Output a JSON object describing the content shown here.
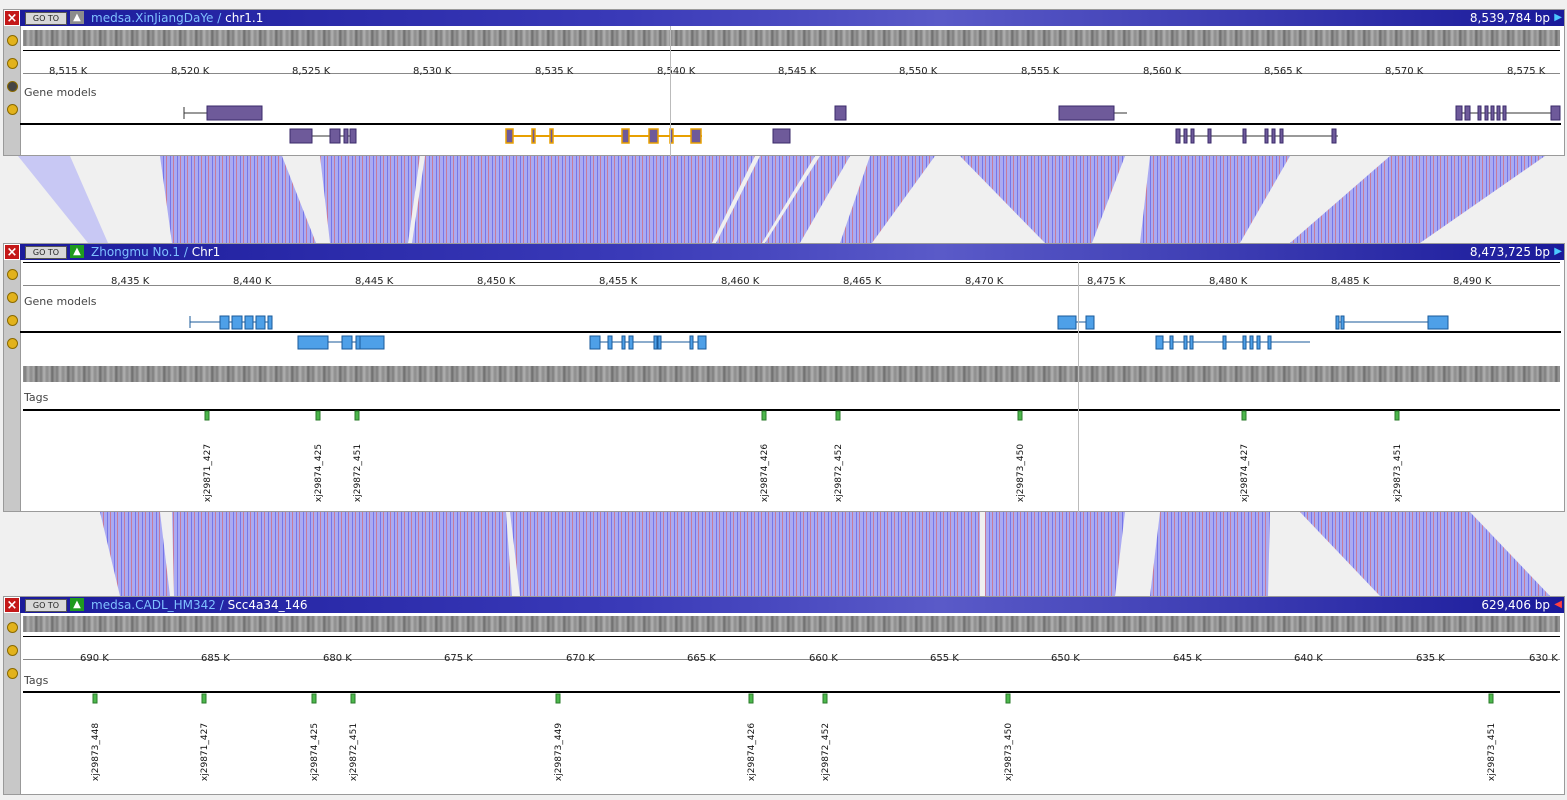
{
  "panels": [
    {
      "id": "top",
      "org": "medsa.XinJiangDaYe",
      "seq": "chr1.1",
      "bp": "8,539,784 bp",
      "goto_label": "GO TO",
      "arrow": "▶",
      "ticks": [
        "8,515 K",
        "8,520 K",
        "8,525 K",
        "8,530 K",
        "8,535 K",
        "8,540 K",
        "8,545 K",
        "8,550 K",
        "8,555 K",
        "8,560 K",
        "8,565 K",
        "8,570 K",
        "8,575 K"
      ],
      "gene_label": "Gene models"
    },
    {
      "id": "middle",
      "org": "Zhongmu No.1",
      "seq": "Chr1",
      "bp": "8,473,725 bp",
      "goto_label": "GO TO",
      "arrow": "▶",
      "ticks": [
        "8,435 K",
        "8,440 K",
        "8,445 K",
        "8,450 K",
        "8,455 K",
        "8,460 K",
        "8,465 K",
        "8,470 K",
        "8,475 K",
        "8,480 K",
        "8,485 K",
        "8,490 K"
      ],
      "gene_label": "Gene models",
      "tags_label": "Tags",
      "tags": [
        "xj29871_427",
        "xj29874_425",
        "xj29872_451",
        "xj29874_426",
        "xj29872_452",
        "xj29873_450",
        "xj29874_427",
        "xj29873_451"
      ]
    },
    {
      "id": "bottom",
      "org": "medsa.CADL_HM342",
      "seq": "Scc4a34_146",
      "bp": "629,406 bp",
      "goto_label": "GO TO",
      "arrow": "◀",
      "ticks": [
        "690 K",
        "685 K",
        "680 K",
        "675 K",
        "670 K",
        "665 K",
        "660 K",
        "655 K",
        "650 K",
        "645 K",
        "640 K",
        "635 K",
        "630 K"
      ],
      "tags_label": "Tags",
      "tags": [
        "xj29873_448",
        "xj29871_427",
        "xj29874_425",
        "xj29872_451",
        "xj29873_449",
        "xj29874_426",
        "xj29872_452",
        "xj29873_450",
        "xj29873_451"
      ]
    }
  ],
  "colors": {
    "title_bar": "#2424a8",
    "top_gene": "#6e5a9a",
    "highlight_gene": "#e8a000",
    "mid_gene": "#4ea0e8",
    "tag": "#4cb84c",
    "synteny_fill": "#8c8cf0",
    "synteny_red": "#d06060"
  }
}
